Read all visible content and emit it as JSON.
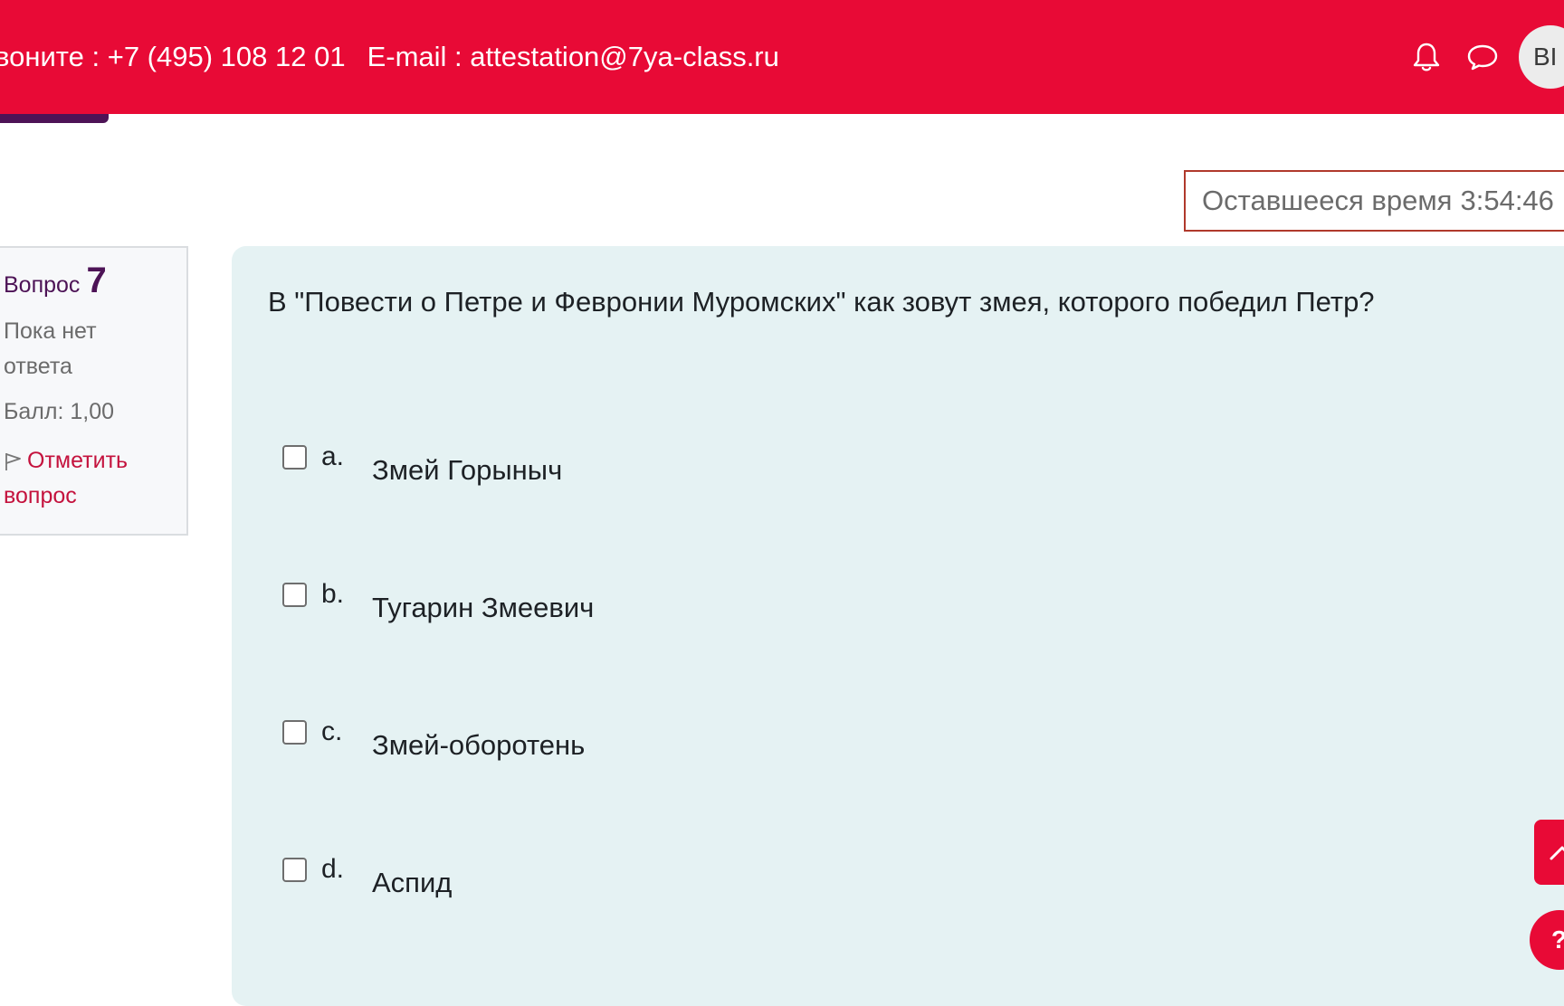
{
  "header": {
    "phone": "воните : +7 (495) 108 12 01",
    "email": "E-mail : attestation@7ya-class.ru",
    "avatar_initials": "ВІ",
    "icons": [
      "bell-icon",
      "chat-icon"
    ]
  },
  "timer": {
    "label": "Оставшееся время",
    "value": "3:54:46"
  },
  "question_info": {
    "label": "Вопрос",
    "number": "7",
    "state": "Пока нет ответа",
    "grade": "Балл: 1,00",
    "flag_label": "Отметить вопрос"
  },
  "question": {
    "text": "В \"Повести о Петре и Февронии Муромских\" как зовут змея, которого победил Петр?",
    "answers": [
      {
        "letter": "a.",
        "text": "Змей Горыныч"
      },
      {
        "letter": "b.",
        "text": "Тугарин Змеевич"
      },
      {
        "letter": "c.",
        "text": "Змей-оборотень"
      },
      {
        "letter": "d.",
        "text": "Аспид"
      }
    ]
  },
  "floating": {
    "help_label": "?"
  },
  "colors": {
    "brand_red": "#e80a36",
    "brand_purple": "#4d1356",
    "question_bg": "#e5f2f3"
  }
}
